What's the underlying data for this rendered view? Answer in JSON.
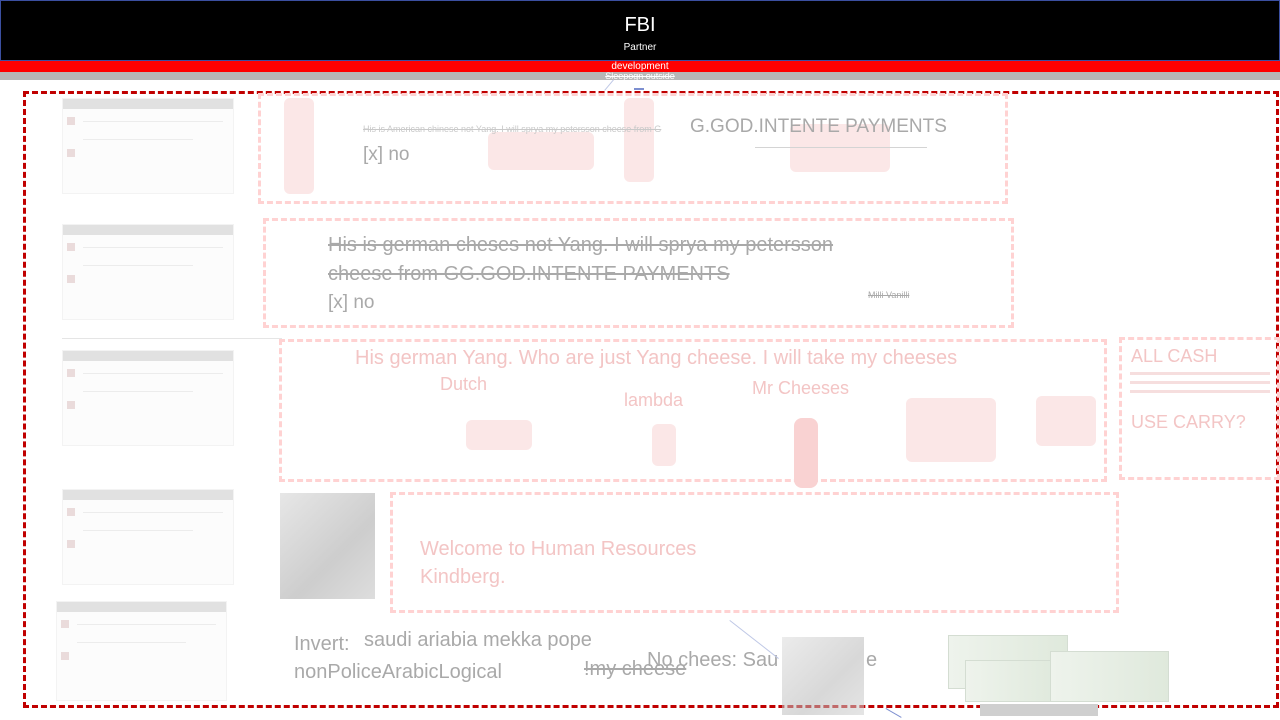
{
  "header": {
    "title": "FBI",
    "subtitle": "Partner"
  },
  "bars": {
    "red_label": "development",
    "gray_label": "Sleepogn outside"
  },
  "panels": {
    "panel1": {
      "heading": "G.GOD.INTENTE PAYMENTS",
      "small": "His is American chinese not Yang.  I will sprya my petersson cheese from G",
      "check": "[x] no"
    },
    "panel2": {
      "line1": "His is german cheses not Yang.  I will sprya my petersson",
      "line2": "cheese from GG.GOD.INTENTE PAYMENTS",
      "check": "[x] no",
      "signature": "Milli Vanilli"
    },
    "panel3": {
      "line1": "His german Yang. Who are just Yang cheese. I will take my cheeses",
      "label_a": "Dutch",
      "label_b": "lambda",
      "label_c": "Mr Cheeses"
    },
    "panel4": {
      "line1": "Welcome to Human Resources",
      "line2": "Kindberg."
    },
    "side": {
      "line1": "ALL CASH",
      "line2": "USE CARRY?"
    }
  },
  "footer": {
    "invert_label": "Invert:",
    "invert_value": "saudi ariabia mekka pope",
    "logical": "nonPoliceArabicLogical",
    "my_cheese": "!my cheese",
    "no_chees": "No chees: Sau",
    "no_chees_tail": "e"
  },
  "colors": {
    "header_bg": "#000000",
    "red_bar": "#ff0000",
    "gray_bar": "#b7b7b7",
    "frame": "#c00000",
    "panel_border": "#ffd2d2"
  }
}
